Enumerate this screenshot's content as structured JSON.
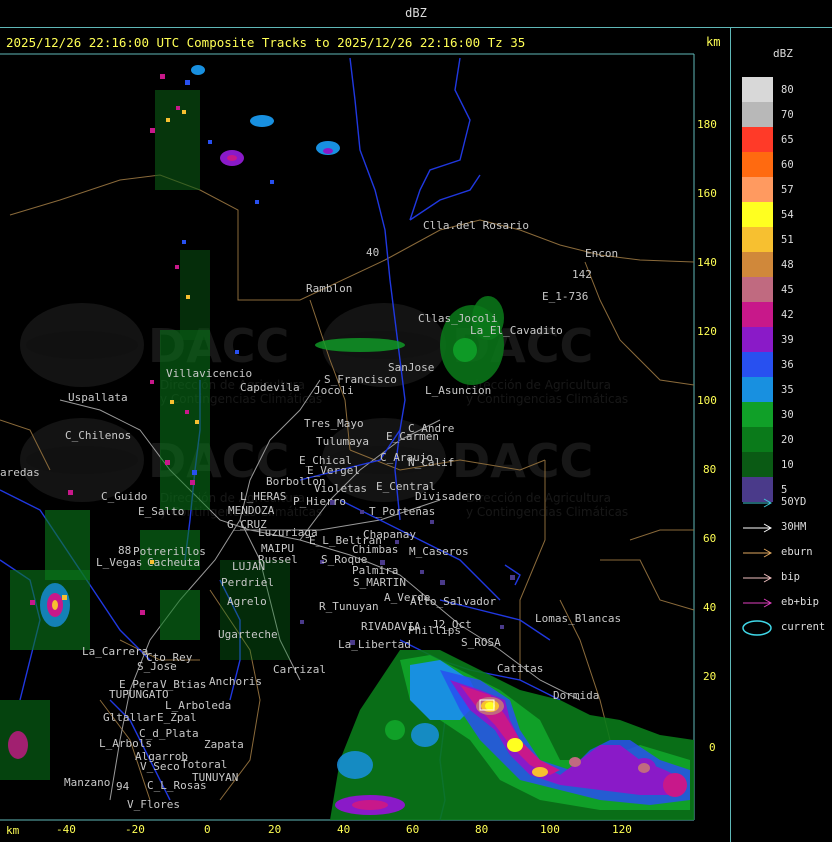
{
  "header": {
    "title": "dBZ"
  },
  "subtitle": "2025/12/26 22:16:00 UTC Composite Tracks to 2025/12/26 22:16:00 Tz 35",
  "axes": {
    "unit": "km",
    "x_ticks": [
      "-40",
      "-20",
      "0",
      "20",
      "40",
      "60",
      "80",
      "100",
      "120"
    ],
    "y_ticks": [
      "180",
      "160",
      "140",
      "120",
      "100",
      "80",
      "60",
      "40",
      "20",
      "0"
    ]
  },
  "legend": {
    "title": "dBZ",
    "levels": [
      {
        "label": "80",
        "color": "#d8d8d8"
      },
      {
        "label": "70",
        "color": "#b8b8b8"
      },
      {
        "label": "65",
        "color": "#ff3a28"
      },
      {
        "label": "60",
        "color": "#ff6a10"
      },
      {
        "label": "57",
        "color": "#ff9a60"
      },
      {
        "label": "54",
        "color": "#ffff20"
      },
      {
        "label": "51",
        "color": "#f7c030"
      },
      {
        "label": "48",
        "color": "#d0883a"
      },
      {
        "label": "45",
        "color": "#c06a80"
      },
      {
        "label": "42",
        "color": "#c8188a"
      },
      {
        "label": "39",
        "color": "#8a1ac8"
      },
      {
        "label": "36",
        "color": "#2850f0"
      },
      {
        "label": "35",
        "color": "#1890e0"
      },
      {
        "label": "30",
        "color": "#10a028"
      },
      {
        "label": "20",
        "color": "#0a7a1a"
      },
      {
        "label": "10",
        "color": "#0a5a14"
      },
      {
        "label": "5",
        "color": "#4a3a8a"
      }
    ],
    "tracks": [
      {
        "label": "50YD",
        "color": "#40c8d8"
      },
      {
        "label": "30HM",
        "color": "#ffffff"
      },
      {
        "label": "eburn",
        "color": "#e0a860"
      },
      {
        "label": "bip",
        "color": "#f0c0c0"
      },
      {
        "label": "eb+bip",
        "color": "#e040c0"
      },
      {
        "label": "current",
        "color": "#40d8e8"
      }
    ]
  },
  "watermark": {
    "name": "DACC",
    "line1": "Dirección de Agricultura",
    "line2": "y Contingencias Climáticas"
  },
  "places": [
    {
      "name": "Clla.del Rosario"
    },
    {
      "name": "Encon"
    },
    {
      "name": "142"
    },
    {
      "name": "E_1-736"
    },
    {
      "name": "Ramblon"
    },
    {
      "name": "Cllas_Jocoli"
    },
    {
      "name": "La_El_Cavadito"
    },
    {
      "name": "Villavicencio"
    },
    {
      "name": "Capdevila"
    },
    {
      "name": "S_Francisco"
    },
    {
      "name": "Jocoli"
    },
    {
      "name": "SanJose"
    },
    {
      "name": "L_Asuncion"
    },
    {
      "name": "Uspallata"
    },
    {
      "name": "Tres_Mayo"
    },
    {
      "name": "C_Andre"
    },
    {
      "name": "C_Chilenos"
    },
    {
      "name": "Tulumaya"
    },
    {
      "name": "E_Carmen"
    },
    {
      "name": "E_Chical"
    },
    {
      "name": "C_Araujo"
    },
    {
      "name": "N_Calif"
    },
    {
      "name": "E_Vergel"
    },
    {
      "name": "aredas"
    },
    {
      "name": "Borbollon"
    },
    {
      "name": "Violetas"
    },
    {
      "name": "E_Central"
    },
    {
      "name": "Divisadero"
    },
    {
      "name": "C_Guido"
    },
    {
      "name": "L_HERAS"
    },
    {
      "name": "P_Hierro"
    },
    {
      "name": "E_Salto"
    },
    {
      "name": "MENDOZA"
    },
    {
      "name": "T_Porteñas"
    },
    {
      "name": "G_CRUZ"
    },
    {
      "name": "Luzuriaga"
    },
    {
      "name": "Chapanay"
    },
    {
      "name": "E_L_Beltran"
    },
    {
      "name": "Potrerillos"
    },
    {
      "name": "Chimbas"
    },
    {
      "name": "M_Caseros"
    },
    {
      "name": "L_Vegas"
    },
    {
      "name": "Cacheuta"
    },
    {
      "name": "MAIPU"
    },
    {
      "name": "Russel"
    },
    {
      "name": "S_Roque"
    },
    {
      "name": "LUJAN"
    },
    {
      "name": "Palmira"
    },
    {
      "name": "Perdriel"
    },
    {
      "name": "S_MARTIN"
    },
    {
      "name": "Agrelo"
    },
    {
      "name": "A_Verde"
    },
    {
      "name": "Alto_Salvador"
    },
    {
      "name": "R_Tunuyan"
    },
    {
      "name": "Ugarteche"
    },
    {
      "name": "Lomas_Blancas"
    },
    {
      "name": "J2_Oct"
    },
    {
      "name": "RIVADAVIA"
    },
    {
      "name": "Phillips"
    },
    {
      "name": "La_Carrera"
    },
    {
      "name": "Cto_Rey"
    },
    {
      "name": "Carrizal"
    },
    {
      "name": "La_Libertad"
    },
    {
      "name": "S_ROSA"
    },
    {
      "name": "S_Jose"
    },
    {
      "name": "Anchoris"
    },
    {
      "name": "Catitas"
    },
    {
      "name": "E_Pera"
    },
    {
      "name": "V_Btias"
    },
    {
      "name": "TUPUNGATO"
    },
    {
      "name": "Dormida"
    },
    {
      "name": "L_Arboleda"
    },
    {
      "name": "Gltallar"
    },
    {
      "name": "E_Zpal"
    },
    {
      "name": "C_d_Plata"
    },
    {
      "name": "L_Arbols"
    },
    {
      "name": "Zapata"
    },
    {
      "name": "Algarrob"
    },
    {
      "name": "V_Seco"
    },
    {
      "name": "Totoral"
    },
    {
      "name": "Manzano"
    },
    {
      "name": "TUNUYAN"
    },
    {
      "name": "C_L_Rosas"
    },
    {
      "name": "V_Flores"
    },
    {
      "name": "88"
    },
    {
      "name": "40"
    },
    {
      "name": "94"
    }
  ]
}
